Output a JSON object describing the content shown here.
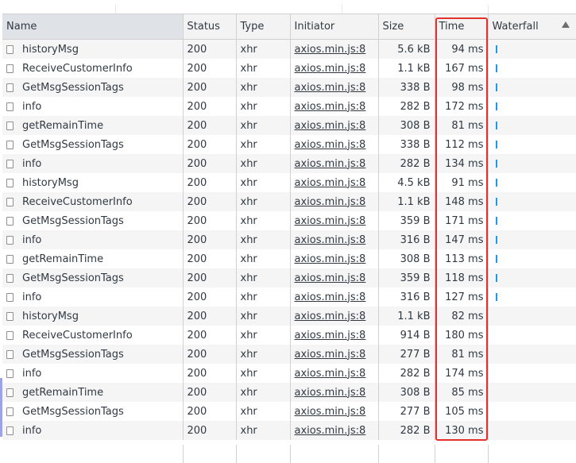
{
  "columns": {
    "name": "Name",
    "status": "Status",
    "type": "Type",
    "initiator": "Initiator",
    "size": "Size",
    "time": "Time",
    "waterfall": "Waterfall"
  },
  "rows": [
    {
      "name": "historyMsg",
      "status": "200",
      "type": "xhr",
      "initiator": "axios.min.js:8",
      "size": "5.6 kB",
      "time": "94 ms",
      "waterfall": true
    },
    {
      "name": "ReceiveCustomerInfo",
      "status": "200",
      "type": "xhr",
      "initiator": "axios.min.js:8",
      "size": "1.1 kB",
      "time": "167 ms",
      "waterfall": true
    },
    {
      "name": "GetMsgSessionTags",
      "status": "200",
      "type": "xhr",
      "initiator": "axios.min.js:8",
      "size": "338 B",
      "time": "98 ms",
      "waterfall": true
    },
    {
      "name": "info",
      "status": "200",
      "type": "xhr",
      "initiator": "axios.min.js:8",
      "size": "282 B",
      "time": "172 ms",
      "waterfall": true
    },
    {
      "name": "getRemainTime",
      "status": "200",
      "type": "xhr",
      "initiator": "axios.min.js:8",
      "size": "308 B",
      "time": "81 ms",
      "waterfall": true
    },
    {
      "name": "GetMsgSessionTags",
      "status": "200",
      "type": "xhr",
      "initiator": "axios.min.js:8",
      "size": "338 B",
      "time": "112 ms",
      "waterfall": true
    },
    {
      "name": "info",
      "status": "200",
      "type": "xhr",
      "initiator": "axios.min.js:8",
      "size": "282 B",
      "time": "134 ms",
      "waterfall": true
    },
    {
      "name": "historyMsg",
      "status": "200",
      "type": "xhr",
      "initiator": "axios.min.js:8",
      "size": "4.5 kB",
      "time": "91 ms",
      "waterfall": true
    },
    {
      "name": "ReceiveCustomerInfo",
      "status": "200",
      "type": "xhr",
      "initiator": "axios.min.js:8",
      "size": "1.1 kB",
      "time": "148 ms",
      "waterfall": true
    },
    {
      "name": "GetMsgSessionTags",
      "status": "200",
      "type": "xhr",
      "initiator": "axios.min.js:8",
      "size": "359 B",
      "time": "171 ms",
      "waterfall": true
    },
    {
      "name": "info",
      "status": "200",
      "type": "xhr",
      "initiator": "axios.min.js:8",
      "size": "316 B",
      "time": "147 ms",
      "waterfall": true
    },
    {
      "name": "getRemainTime",
      "status": "200",
      "type": "xhr",
      "initiator": "axios.min.js:8",
      "size": "308 B",
      "time": "113 ms",
      "waterfall": true
    },
    {
      "name": "GetMsgSessionTags",
      "status": "200",
      "type": "xhr",
      "initiator": "axios.min.js:8",
      "size": "359 B",
      "time": "118 ms",
      "waterfall": true
    },
    {
      "name": "info",
      "status": "200",
      "type": "xhr",
      "initiator": "axios.min.js:8",
      "size": "316 B",
      "time": "127 ms",
      "waterfall": true
    },
    {
      "name": "historyMsg",
      "status": "200",
      "type": "xhr",
      "initiator": "axios.min.js:8",
      "size": "1.1 kB",
      "time": "82 ms",
      "waterfall": false
    },
    {
      "name": "ReceiveCustomerInfo",
      "status": "200",
      "type": "xhr",
      "initiator": "axios.min.js:8",
      "size": "914 B",
      "time": "180 ms",
      "waterfall": false
    },
    {
      "name": "GetMsgSessionTags",
      "status": "200",
      "type": "xhr",
      "initiator": "axios.min.js:8",
      "size": "277 B",
      "time": "81 ms",
      "waterfall": false
    },
    {
      "name": "info",
      "status": "200",
      "type": "xhr",
      "initiator": "axios.min.js:8",
      "size": "282 B",
      "time": "174 ms",
      "waterfall": false
    },
    {
      "name": "getRemainTime",
      "status": "200",
      "type": "xhr",
      "initiator": "axios.min.js:8",
      "size": "308 B",
      "time": "85 ms",
      "waterfall": false
    },
    {
      "name": "GetMsgSessionTags",
      "status": "200",
      "type": "xhr",
      "initiator": "axios.min.js:8",
      "size": "277 B",
      "time": "105 ms",
      "waterfall": false
    },
    {
      "name": "info",
      "status": "200",
      "type": "xhr",
      "initiator": "axios.min.js:8",
      "size": "282 B",
      "time": "130 ms",
      "waterfall": false
    }
  ],
  "colors": {
    "highlight": "#e5312d",
    "waterfall_bar": "#1a9bf0",
    "sorted_header": "#dfe2e7"
  },
  "icons": {
    "sort": "sort-ascending-icon",
    "row": "document-file-icon"
  }
}
